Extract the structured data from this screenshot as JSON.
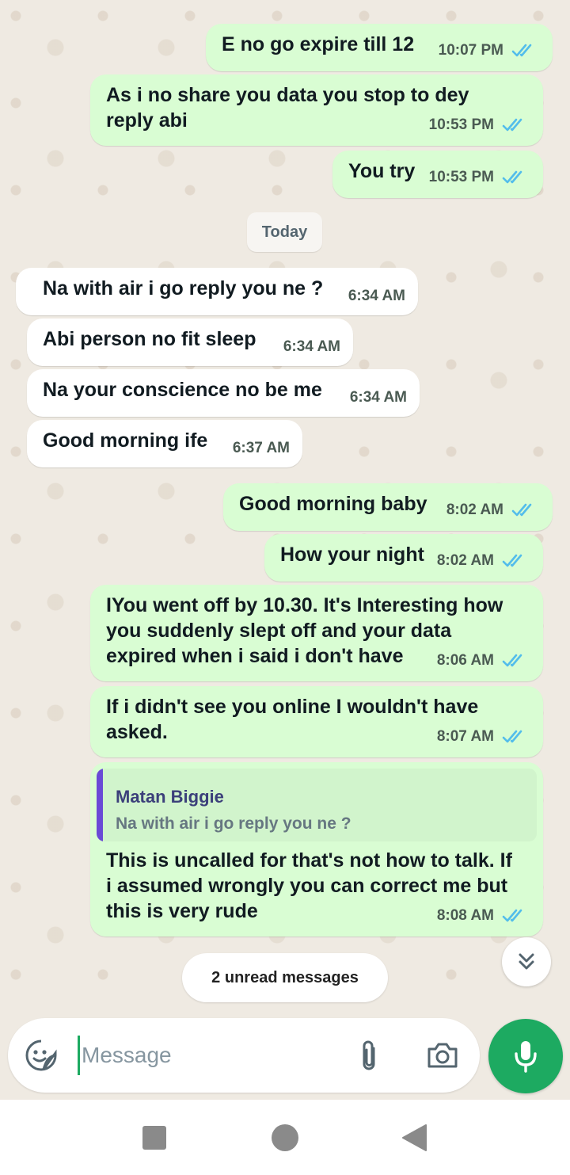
{
  "messages": [
    {
      "dir": "out",
      "text": "E no go expire till 12",
      "time": "10:07 PM"
    },
    {
      "dir": "out",
      "text": "As i no share you data you stop to dey reply abi",
      "time": "10:53 PM"
    },
    {
      "dir": "out",
      "text": "You try",
      "time": "10:53 PM"
    },
    {
      "dir": "in",
      "text": "Na with air i go reply you ne ?",
      "time": "6:34 AM"
    },
    {
      "dir": "in",
      "text": "Abi person no fit sleep",
      "time": "6:34 AM"
    },
    {
      "dir": "in",
      "text": "Na your conscience no be me",
      "time": "6:34 AM"
    },
    {
      "dir": "in",
      "text": "Good morning ife",
      "time": "6:37 AM"
    },
    {
      "dir": "out",
      "text": "Good morning baby",
      "time": "8:02 AM"
    },
    {
      "dir": "out",
      "text": "How your night",
      "time": "8:02 AM"
    },
    {
      "dir": "out",
      "text": "IYou went off by 10.30. It's Interesting how you suddenly slept off and your data expired when i said i don't have",
      "time": "8:06 AM"
    },
    {
      "dir": "out",
      "text": "If i didn't see you online I wouldn't have asked.",
      "time": "8:07 AM"
    },
    {
      "dir": "out",
      "text": "This is uncalled for that's not how to talk. If i assumed wrongly you can correct me but this is very rude",
      "time": "8:08 AM",
      "quote": {
        "name": "Matan Biggie",
        "text": "Na with air i go reply you ne ?"
      }
    }
  ],
  "date_divider": "Today",
  "unread_label": "2 unread messages",
  "composer": {
    "placeholder": "Message"
  },
  "icons": {
    "sticker": "sticker-icon",
    "attach": "paperclip-icon",
    "camera": "camera-icon",
    "mic": "microphone-icon",
    "scroll": "double-chevron-down-icon"
  },
  "colors": {
    "outgoing": "#d9fdd3",
    "incoming": "#ffffff",
    "accent": "#1daa61",
    "read_ticks": "#53bdeb",
    "quote_bar": "#6a4ad6"
  }
}
